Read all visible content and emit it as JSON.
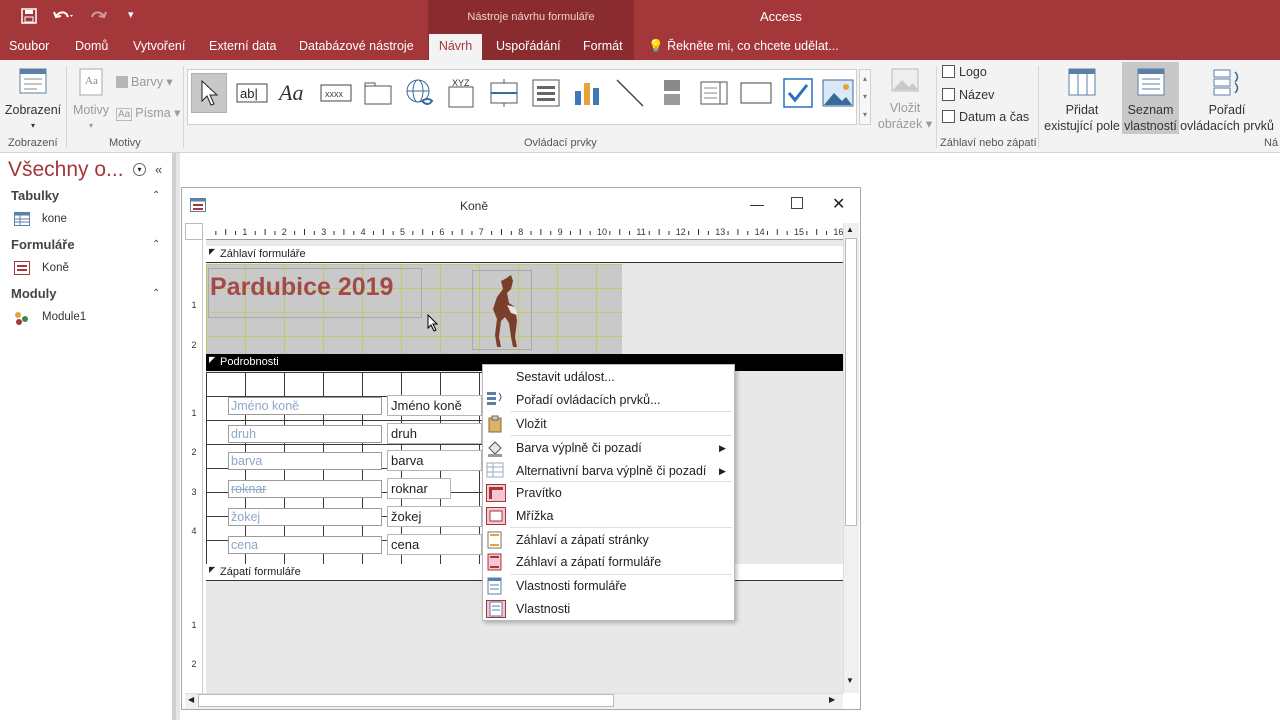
{
  "app": {
    "title": "Access",
    "context_tab_group": "Nástroje návrhu formuláře"
  },
  "qat": {
    "save_icon": "save-icon",
    "undo_icon": "undo-icon",
    "redo_icon": "redo-icon",
    "customize_icon": "customize-icon"
  },
  "tabs": {
    "file": "Soubor",
    "home": "Domů",
    "create": "Vytvoření",
    "external": "Externí data",
    "dbtools": "Databázové nástroje",
    "design": "Návrh",
    "arrange": "Uspořádání",
    "format": "Formát",
    "tellme": "Řekněte mi, co chcete udělat..."
  },
  "ribbon": {
    "views": {
      "label": "Zobrazení",
      "group": "Zobrazení"
    },
    "themes": {
      "themes_label": "Motivy",
      "colors": "Barvy",
      "fonts": "Písma",
      "group": "Motivy"
    },
    "controls": {
      "group": "Ovládací prvky"
    },
    "insert_image": {
      "line1": "Vložit",
      "line2": "obrázek"
    },
    "header_footer": {
      "logo": "Logo",
      "title": "Název",
      "datetime": "Datum a čas",
      "group": "Záhlaví nebo zápatí"
    },
    "add_fields": {
      "line1": "Přidat",
      "line2": "existující pole"
    },
    "property_sheet": {
      "line1": "Seznam",
      "line2": "vlastností"
    },
    "tab_order": {
      "line1": "Pořadí",
      "line2": "ovládacích prvků"
    },
    "tools_group": "Ná"
  },
  "nav": {
    "header": "Všechny o...",
    "sections": [
      {
        "title": "Tabulky",
        "items": [
          "kone"
        ]
      },
      {
        "title": "Formuláře",
        "items": [
          "Koně"
        ]
      },
      {
        "title": "Moduly",
        "items": [
          "Module1"
        ]
      }
    ]
  },
  "form": {
    "window_title": "Koně",
    "ruler_top": [
      "1",
      "2",
      "3",
      "4",
      "5",
      "6",
      "7",
      "8",
      "9",
      "10",
      "11",
      "12",
      "13",
      "14",
      "15",
      "16"
    ],
    "sections": {
      "header": "Záhlaví formuláře",
      "detail": "Podrobnosti",
      "footer": "Zápatí formuláře"
    },
    "header_title": "Pardubice 2019",
    "fields": [
      {
        "label": "Jméno koně",
        "control": "Jméno koně"
      },
      {
        "label": "druh",
        "control": "druh"
      },
      {
        "label": "barva",
        "control": "barva"
      },
      {
        "label": "roknar",
        "control": "roknar"
      },
      {
        "label": "žokej",
        "control": "žokej"
      },
      {
        "label": "cena",
        "control": "cena"
      }
    ]
  },
  "context_menu": [
    "Sestavit událost...",
    "Pořadí ovládacích prvků...",
    "Vložit",
    "Barva výplně či pozadí",
    "Alternativní barva výplně či pozadí",
    "Pravítko",
    "Mřížka",
    "Záhlaví a zápatí stránky",
    "Záhlaví a zápatí formuláře",
    "Vlastnosti formuláře",
    "Vlastnosti"
  ],
  "colors": {
    "accent": "#a4373a",
    "selected_bg": "#c8c8c8"
  }
}
